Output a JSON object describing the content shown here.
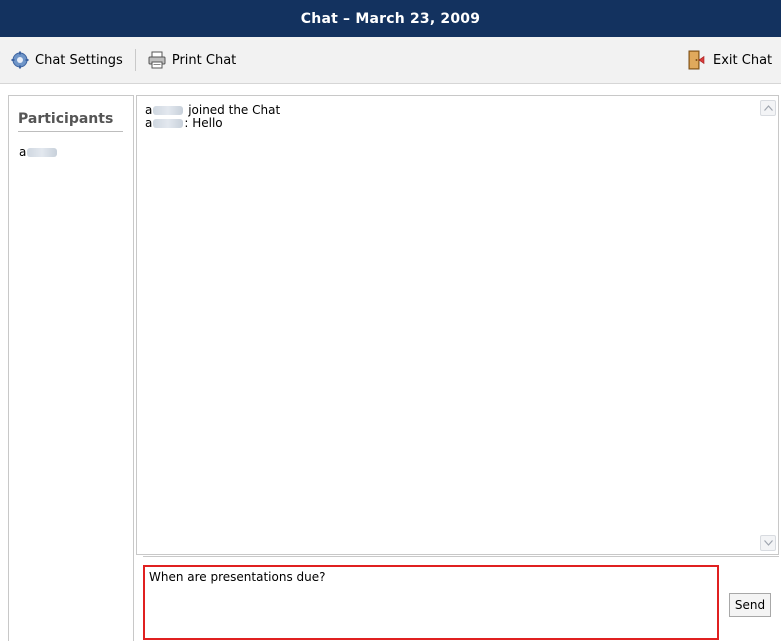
{
  "window": {
    "title": "Chat – March 23, 2009"
  },
  "toolbar": {
    "chat_settings": {
      "label": "Chat Settings",
      "icon": "chat-settings-icon"
    },
    "print_chat": {
      "label": "Print Chat",
      "icon": "printer-icon"
    },
    "exit_chat": {
      "label": "Exit Chat",
      "icon": "exit-door-icon"
    }
  },
  "participants": {
    "heading": "Participants",
    "items": [
      {
        "prefix": "a",
        "name_redacted": true
      }
    ]
  },
  "chat_log": {
    "messages": [
      {
        "prefix": "a",
        "text": "joined the Chat"
      },
      {
        "prefix": "a",
        "text": ": Hello"
      }
    ]
  },
  "composer": {
    "value": "When are presentations due?",
    "send_label": "Send"
  },
  "colors": {
    "titlebar": "#13325f",
    "highlight_border": "#e02020"
  }
}
